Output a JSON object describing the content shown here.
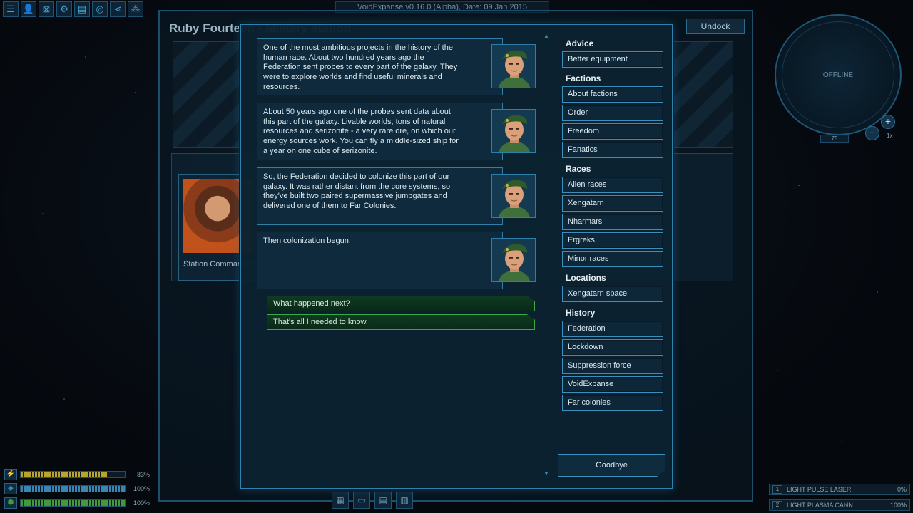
{
  "version_text": "VoidExpanse v0.16.0 (Alpha), Date: 09 Jan 2015",
  "toolbar": {
    "icons": [
      {
        "name": "menu-icon",
        "glyph": "☰"
      },
      {
        "name": "pilot-icon",
        "glyph": "👤"
      },
      {
        "name": "map-icon",
        "glyph": "⊠"
      },
      {
        "name": "skills-icon",
        "glyph": "⚙"
      },
      {
        "name": "log-icon",
        "glyph": "▤"
      },
      {
        "name": "target-icon",
        "glyph": "◎"
      },
      {
        "name": "share-icon",
        "glyph": "⋖"
      },
      {
        "name": "grid-icon",
        "glyph": "⁂"
      }
    ]
  },
  "station": {
    "title": "Ruby Fourteen - Military station",
    "undock_label": "Undock",
    "commander_label": "Station Commander"
  },
  "radar": {
    "status": "OFFLINE",
    "range": "75",
    "zoom_in": "+",
    "zoom_out": "−",
    "zoom_level": "1x"
  },
  "status_bars": [
    {
      "name": "energy",
      "icon": "⚡",
      "percent": 83,
      "label": "83%",
      "color": "#b8a52c"
    },
    {
      "name": "shield",
      "icon": "◆",
      "percent": 100,
      "label": "100%",
      "color": "#3a86b3"
    },
    {
      "name": "hull",
      "icon": "⬢",
      "percent": 100,
      "label": "100%",
      "color": "#3f9a3a"
    }
  ],
  "weapons": [
    {
      "key": "1",
      "name": "LIGHT PULSE LASER",
      "value": "0%"
    },
    {
      "key": "2",
      "name": "LIGHT PLASMA CANN...",
      "value": "100%"
    }
  ],
  "dialog": {
    "messages": [
      "One of the most ambitious projects in the history of the human race. About two hundred years ago the Federation sent probes to every part of the galaxy. They were to explore worlds and find useful minerals and resources.",
      "About 50 years ago one of the probes sent data about this part of the galaxy. Livable worlds, tons of natural resources and serizonite - a very rare ore, on which our energy sources work. You can fly a middle-sized ship for a year on one cube of serizonite.",
      "So, the Federation decided to colonize this part of our galaxy. It was rather distant from the core systems, so they've built two paired supermassive jumpgates and delivered one of them to Far Colonies.",
      "Then colonization begun."
    ],
    "replies": [
      "What happened next?",
      "That's all I needed to know."
    ],
    "goodbye_label": "Goodbye"
  },
  "topics": {
    "advice": {
      "heading": "Advice",
      "items": [
        "Better equipment"
      ]
    },
    "factions": {
      "heading": "Factions",
      "items": [
        "About factions",
        "Order",
        "Freedom",
        "Fanatics"
      ]
    },
    "races": {
      "heading": "Races",
      "items": [
        "Alien races",
        "Xengatarn",
        "Nharmars",
        "Ergreks",
        "Minor races"
      ]
    },
    "locations": {
      "heading": "Locations",
      "items": [
        "Xengatarn space"
      ]
    },
    "history": {
      "heading": "History",
      "items": [
        "Federation",
        "Lockdown",
        "Suppression force",
        "VoidExpanse",
        "Far colonies"
      ]
    }
  }
}
